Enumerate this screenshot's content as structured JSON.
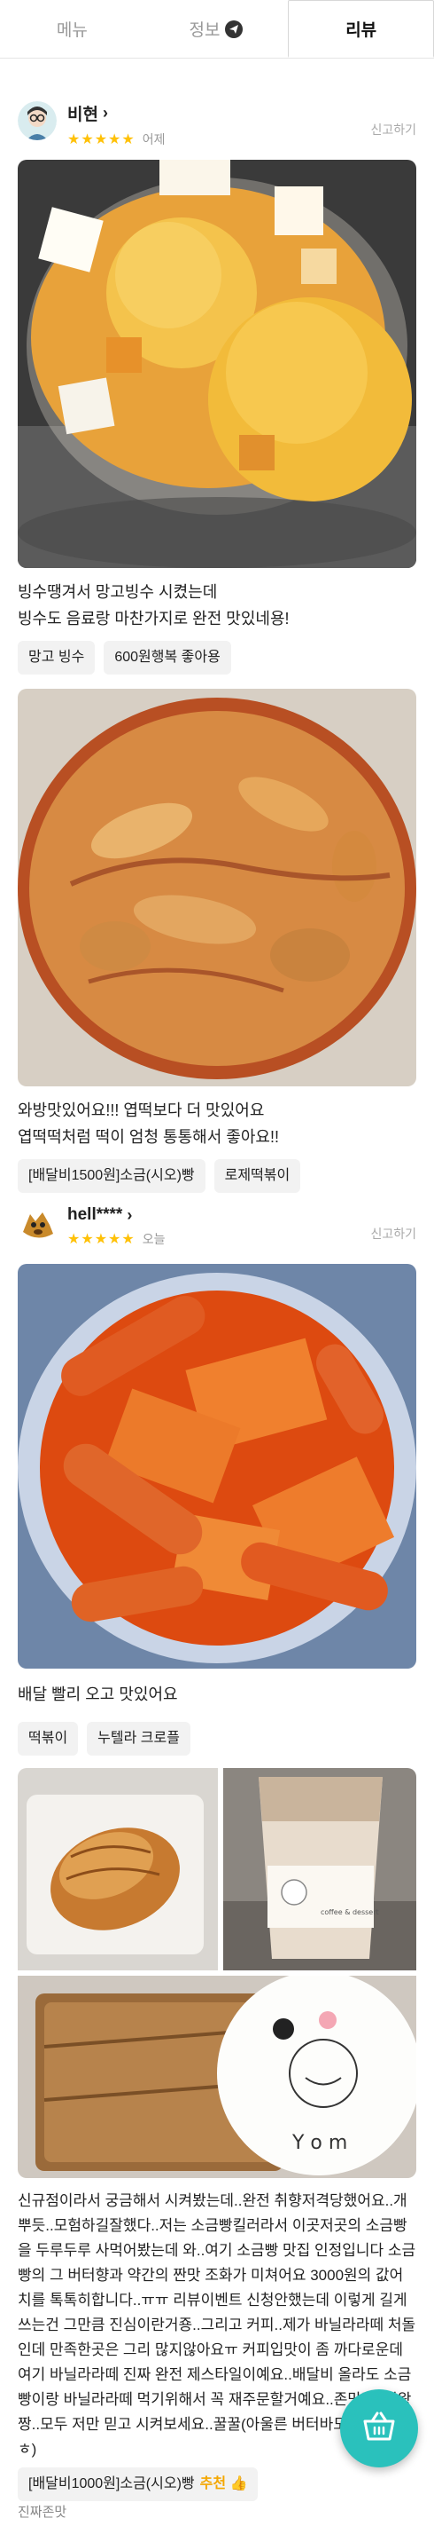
{
  "tabs": [
    {
      "label": "메뉴"
    },
    {
      "label": "정보"
    },
    {
      "label": "리뷰"
    }
  ],
  "reviews": [
    {
      "name": "비현",
      "stars": "★★★★★",
      "date": "어제",
      "report": "신고하기",
      "text1": "빙수땡겨서 망고빙수 시켰는데\n빙수도 음료랑 마찬가지로 완전 맛있네용!",
      "tags1": [
        "망고 빙수",
        "600원행복 좋아용"
      ],
      "text2": "와방맛있어요!!! 엽떡보다 더 맛있어요\n엽떡떡처럼 떡이 엄청 통통해서 좋아요!!",
      "tags2": [
        "[배달비1500원]소금(시오)빵",
        "로제떡볶이"
      ]
    },
    {
      "name": "hell****",
      "stars": "★★★★★",
      "date": "오늘",
      "report": "신고하기",
      "text1": "배달 빨리 오고 맛있어요",
      "tags1": [
        "떡볶이",
        "누텔라 크로플"
      ],
      "text2": "신규점이라서 궁금해서 시켜봤는데..완전 취향저격당했어요..개뿌듯..모험하길잘했다..저는 소금빵킬러라서 이곳저곳의 소금빵을 두루두루 사먹어봤는데 와..여기 소금빵 맛집 인정입니다 소금빵의 그 버터향과 약간의 짠맛 조화가 미쳐어요 3000원의 값어치를 톡톡히합니다..ㅠㅠ 리뷰이벤트 신청안했는데 이렇게 길게 쓰는건 그만큼 진심이란거죵..그리고 커피..제가 바닐라라떼 처돌인데 만족한곳은 그리 많지않아요ㅠ 커피입맛이 좀 까다로운데 여기 바닐라라떼 진짜 완전 제스타일이예요..배달비 올라도 소금빵이랑 바닐라라떼 먹기위해서 꼭 재주문할거예요..존맛탱..킹왕짱..모두 저만 믿고 시켜보세요..꿀꿀(아울른 버터바도 맛있음ㅎ.ㅎ)",
      "tags2": [
        "[배달비1000원]소금(시오)빵"
      ],
      "recommend": "추천",
      "footer": "진짜존맛"
    }
  ],
  "photo_caption": "Y o m",
  "cup_text": "coffee & dessert",
  "icons": {
    "info": "paper-plane-icon",
    "fab": "basket-icon",
    "chevron": "chevron-right-icon"
  },
  "colors": {
    "accent": "#2ac1bc",
    "star": "#ffc107"
  }
}
